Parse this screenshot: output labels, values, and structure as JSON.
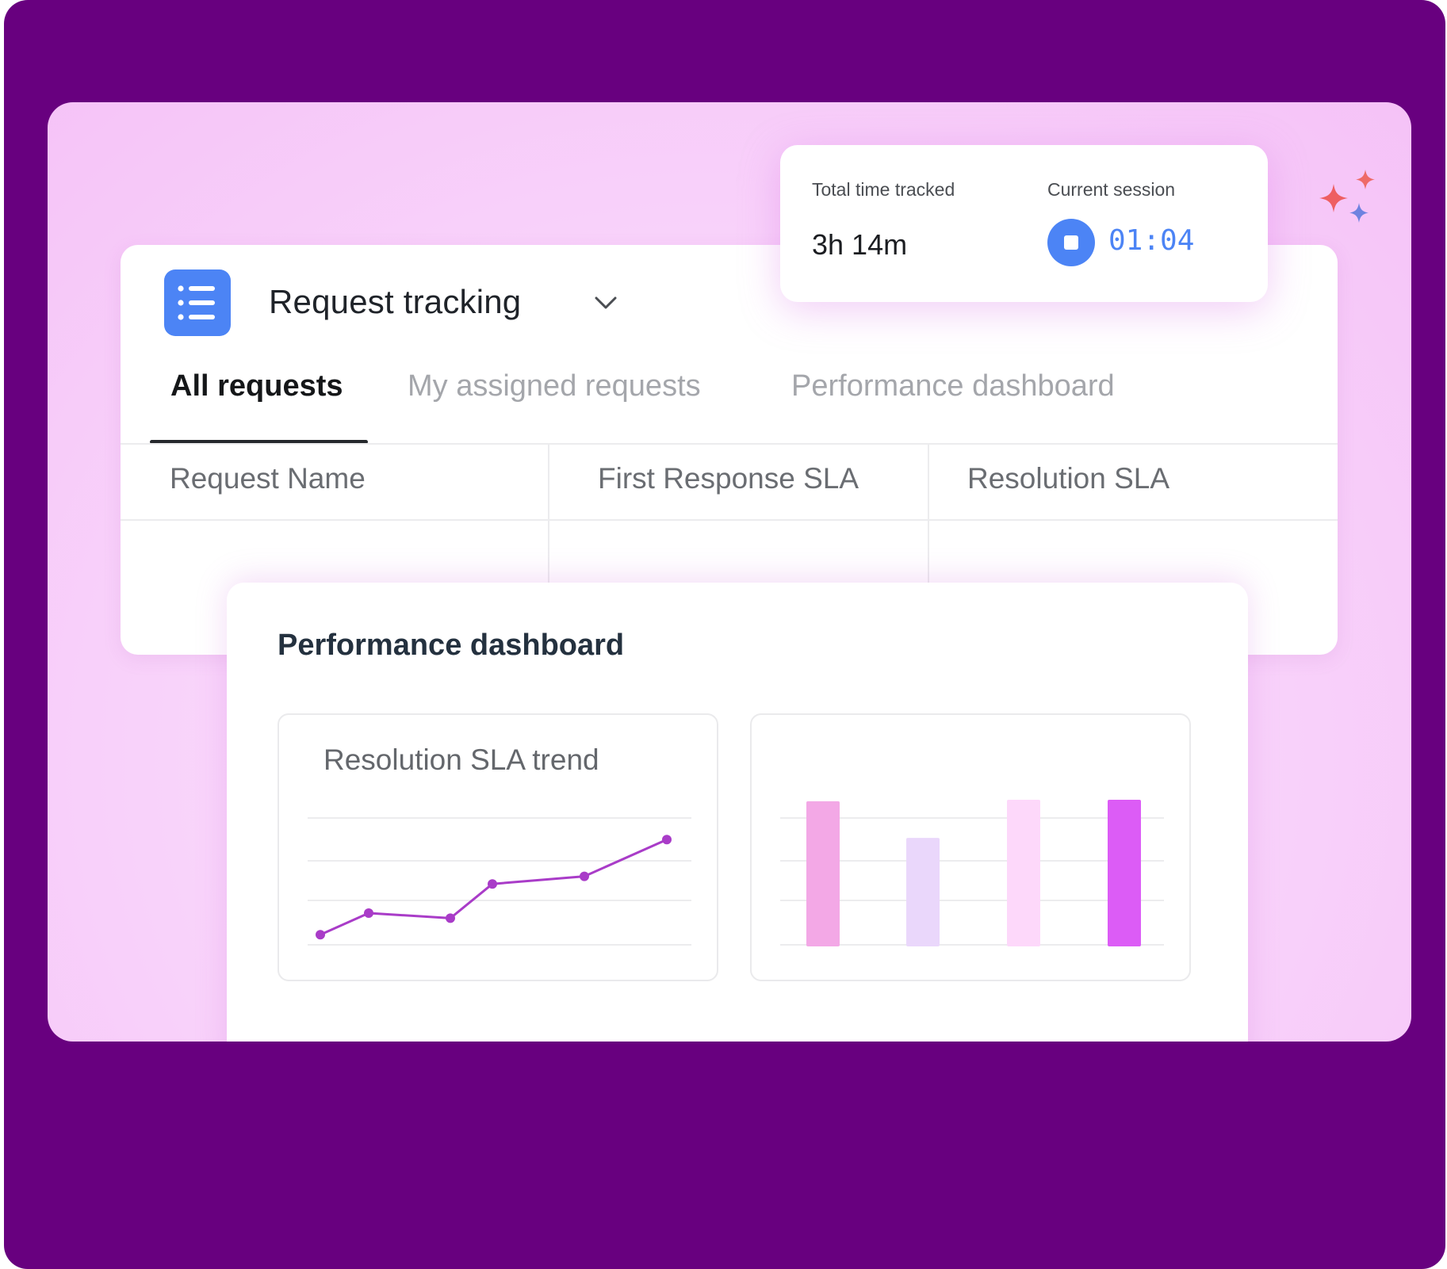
{
  "app": {
    "title": "Request tracking",
    "icon": "list-icon"
  },
  "tabs": [
    {
      "label": "All requests",
      "active": true
    },
    {
      "label": "My assigned requests",
      "active": false
    },
    {
      "label": "Performance dashboard",
      "active": false
    }
  ],
  "table": {
    "columns": [
      "Request Name",
      "First Response SLA",
      "Resolution SLA"
    ]
  },
  "timer": {
    "total_label": "Total time tracked",
    "total_value": "3h 14m",
    "session_label": "Current session",
    "session_value": "01:04",
    "stop_icon": "stop-icon"
  },
  "dashboard": {
    "title": "Performance dashboard"
  },
  "colors": {
    "frame": "#68007f",
    "accent_blue": "#4c84f5",
    "line": "#a93cc8",
    "bars": [
      "#f3a8e6",
      "#ead7fb",
      "#fdd8fa",
      "#dc5cf6"
    ],
    "sparkle_red": "#ee5f62",
    "sparkle_blue": "#6e82e0"
  },
  "chart_data": [
    {
      "type": "line",
      "title": "Resolution SLA trend",
      "x": [
        1,
        2,
        3,
        4,
        5,
        6
      ],
      "values": [
        0.08,
        0.25,
        0.21,
        0.48,
        0.54,
        0.83
      ],
      "ylim": [
        0,
        1
      ],
      "grid": true
    },
    {
      "type": "bar",
      "title": "",
      "values": [
        0.99,
        0.74,
        1.0,
        1.0
      ],
      "ylim": [
        0,
        1
      ],
      "grid": true
    }
  ]
}
